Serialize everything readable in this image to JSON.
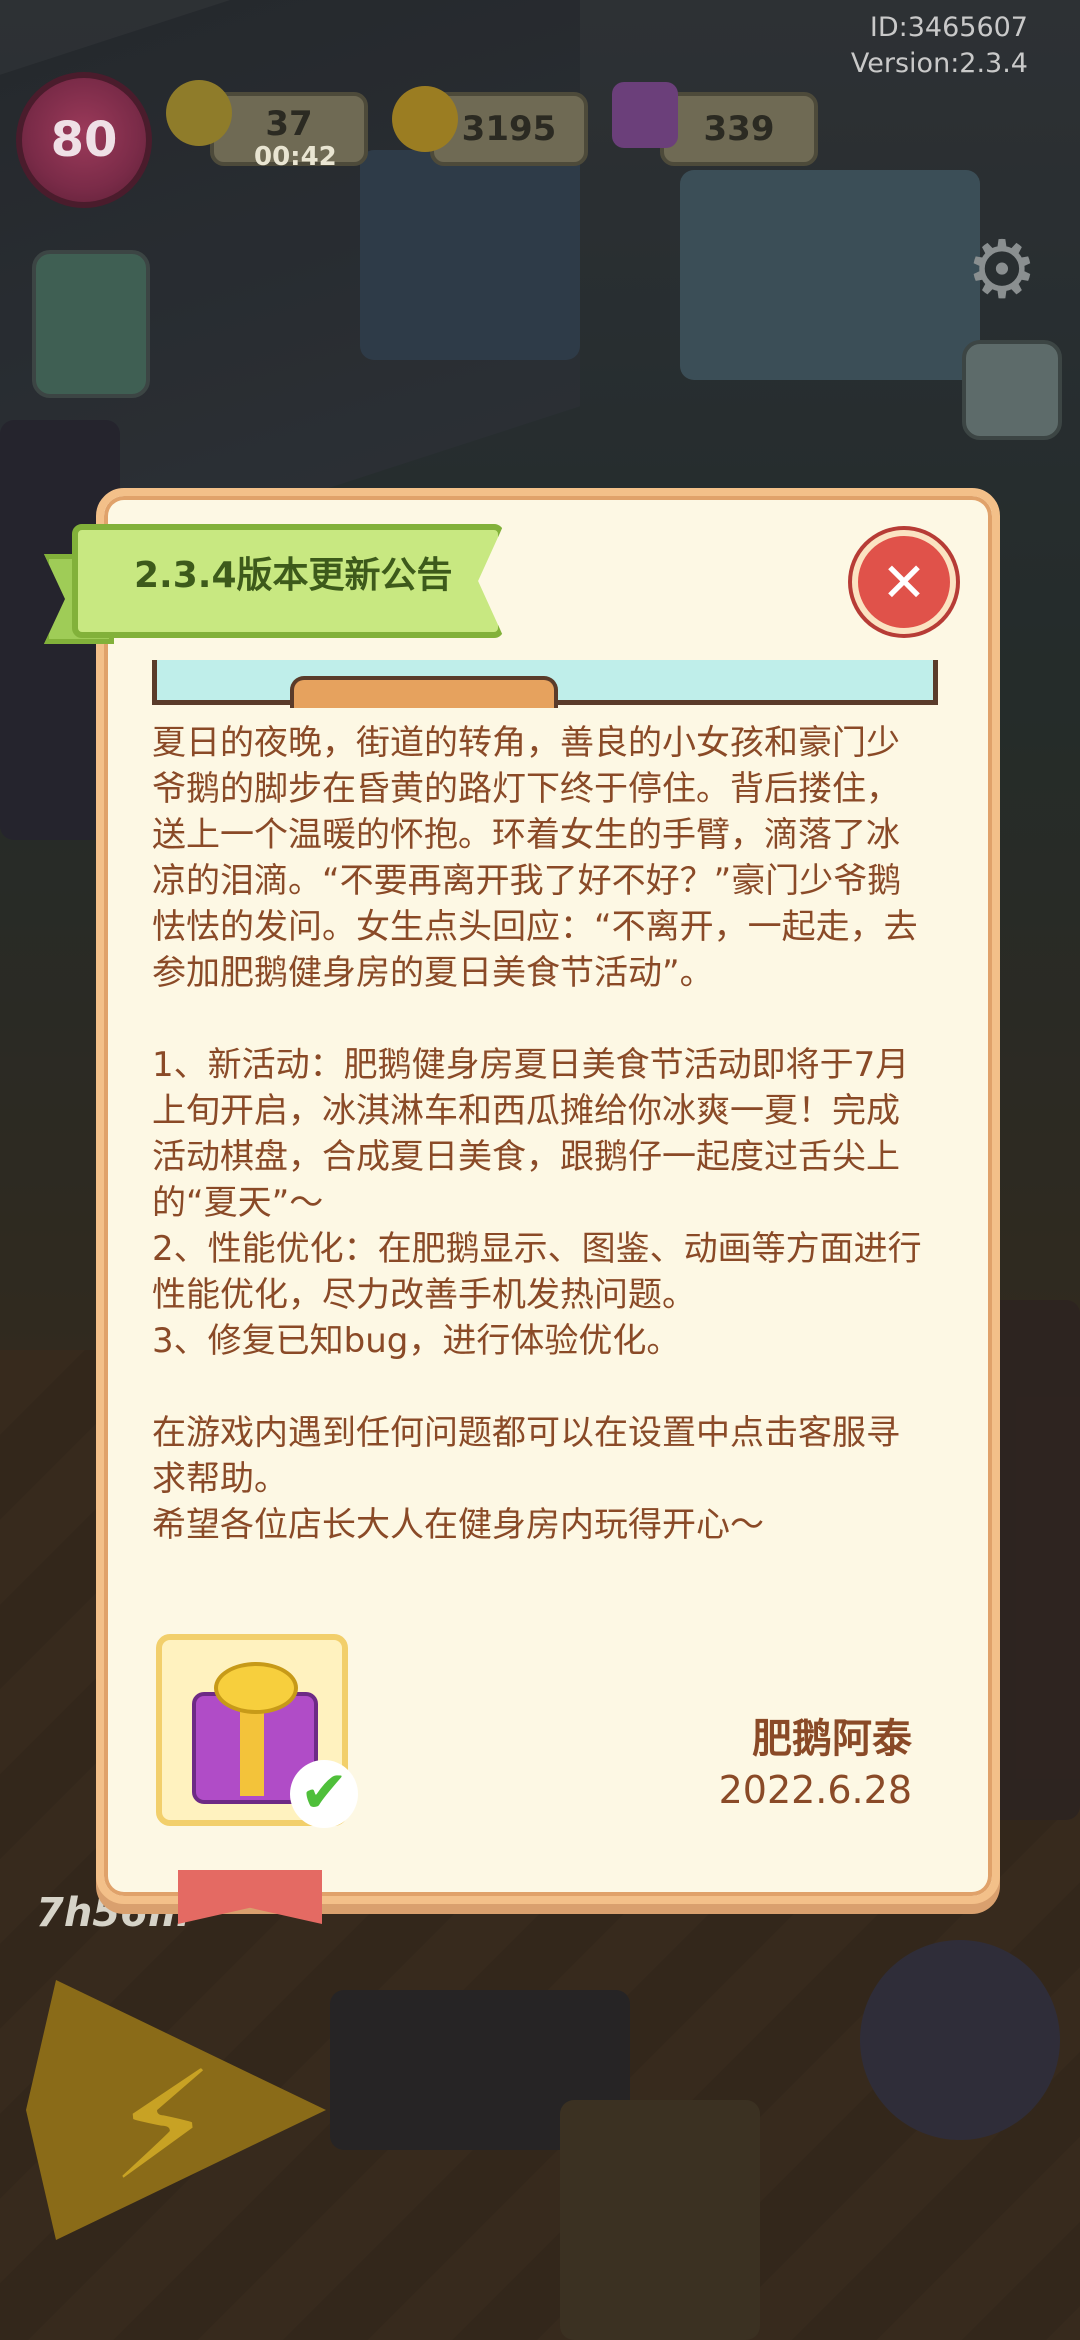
{
  "hud": {
    "level": "80",
    "energy": "37",
    "energy_timer": "00:42",
    "coins": "3195",
    "gems": "339",
    "build_timer": "7h56m"
  },
  "app_info": {
    "id_text": "ID:3465607",
    "version_text": "Version:2.3.4"
  },
  "dialog": {
    "title": "2.3.4版本更新公告",
    "close_icon": "close-x",
    "paragraphs": {
      "story": "夏日的夜晚，街道的转角，善良的小女孩和豪门少爷鹅的脚步在昏黄的路灯下终于停住。背后搂住，送上一个温暖的怀抱。环着女生的手臂，滴落了冰凉的泪滴。“不要再离开我了好不好？”豪门少爷鹅怯怯的发问。女生点头回应：“不离开，一起走，去参加肥鹅健身房的夏日美食节活动”。",
      "item1": "1、新活动：肥鹅健身房夏日美食节活动即将于7月上旬开启，冰淇淋车和西瓜摊给你冰爽一夏！完成活动棋盘，合成夏日美食，跟鹅仔一起度过舌尖上的“夏天”～",
      "item2": "2、性能优化：在肥鹅显示、图鉴、动画等方面进行性能优化，尽力改善手机发热问题。",
      "item3": "3、修复已知bug，进行体验优化。",
      "help": "在游戏内遇到任何问题都可以在设置中点击客服寻求帮助。",
      "wish": "希望各位店长大人在健身房内玩得开心～"
    },
    "signature": "肥鹅阿泰",
    "date": "2022.6.28",
    "reward_icon": "gift-box",
    "reward_claimed": true
  },
  "colors": {
    "dialog_bg": "#fdf8e4",
    "dialog_border": "#f3c089",
    "text": "#8a4a27",
    "ribbon": "#c8e881",
    "close": "#e0524a"
  }
}
